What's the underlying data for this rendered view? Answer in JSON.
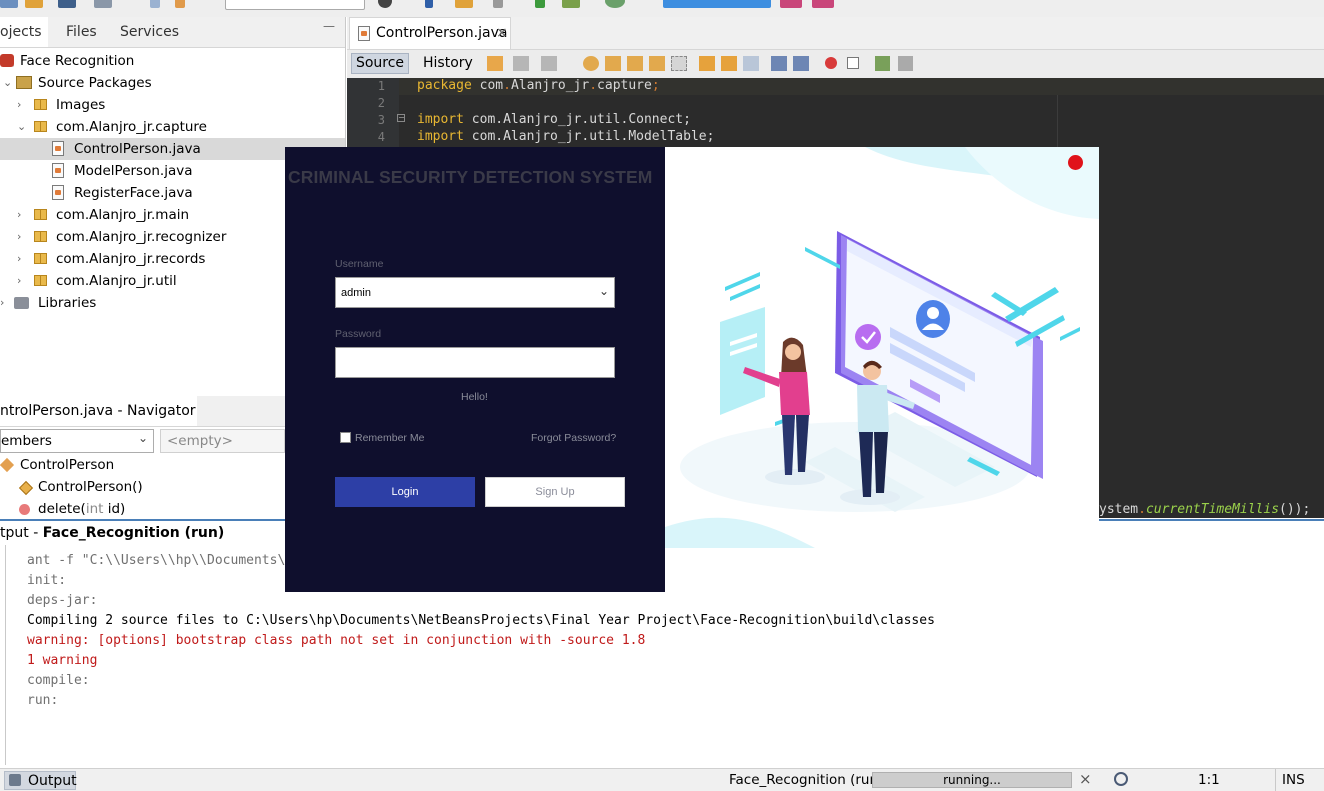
{
  "projects_panel": {
    "tabs": [
      "ojects",
      "Files",
      "Services"
    ],
    "close_glyph": "×",
    "minimize_glyph": "—",
    "tree": [
      {
        "label": "Face Recognition",
        "indent": 0
      },
      {
        "label": "Source Packages",
        "indent": 1
      },
      {
        "label": "Images",
        "indent": 2
      },
      {
        "label": "com.Alanjro_jr.capture",
        "indent": 2
      },
      {
        "label": "ControlPerson.java",
        "indent": 3
      },
      {
        "label": "ModelPerson.java",
        "indent": 3
      },
      {
        "label": "RegisterFace.java",
        "indent": 3
      },
      {
        "label": "com.Alanjro_jr.main",
        "indent": 2
      },
      {
        "label": "com.Alanjro_jr.recognizer",
        "indent": 2
      },
      {
        "label": "com.Alanjro_jr.records",
        "indent": 2
      },
      {
        "label": "com.Alanjro_jr.util",
        "indent": 2
      },
      {
        "label": "Libraries",
        "indent": 1
      }
    ]
  },
  "navigator": {
    "title": "ntrolPerson.java - Navigator",
    "close_glyph": "×",
    "filter_value": "embers",
    "empty_value": "<empty>",
    "items": [
      "ControlPerson",
      "ControlPerson()",
      "delete(int id)"
    ],
    "delete_name": "delete(",
    "delete_type": "int",
    "delete_param": " id)"
  },
  "editor": {
    "tab_label": "ControlPerson.java",
    "tab_close": "×",
    "source_tab": "Source",
    "history_tab": "History",
    "lines": [
      {
        "n": "1",
        "kw": "package",
        "rest": " com",
        "rest2": "Alanjro_jr",
        "rest3": "capture",
        "end": ";"
      },
      {
        "n": "2"
      },
      {
        "n": "3",
        "kw": "import",
        "rest": " com.Alanjro_jr.util.Connect;"
      },
      {
        "n": "4",
        "kw": "import",
        "rest": " com.Alanjro_jr.util.ModelTable;"
      }
    ],
    "fragment_plain": "ystem",
    "fragment_dot": ".",
    "fragment_italic": "currentTimeMillis",
    "fragment_end": "());"
  },
  "output": {
    "title_prefix": "tput - ",
    "title_bold": "Face_Recognition (run)",
    "lines": [
      {
        "text": "ant -f \"C:\\\\Users\\\\hp\\\\Documents\\",
        "color": "gray"
      },
      {
        "text": "init:",
        "color": "gray"
      },
      {
        "text": "deps-jar:",
        "color": "gray"
      },
      {
        "text": "Compiling 2 source files to C:\\Users\\hp\\Documents\\NetBeansProjects\\Final Year Project\\Face-Recognition\\build\\classes",
        "color": "black"
      },
      {
        "text": "warning: [options] bootstrap class path not set in conjunction with -source 1.8",
        "color": "red"
      },
      {
        "text": "1 warning",
        "color": "red"
      },
      {
        "text": "compile:",
        "color": "gray"
      },
      {
        "text": "run:",
        "color": "gray"
      }
    ]
  },
  "status_bar": {
    "output_tab": "Output",
    "task": "Face_Recognition (run)",
    "progress_text": "running...",
    "cancel_glyph": "×",
    "position": "1:1",
    "mode": "INS"
  },
  "login": {
    "title": "CRIMINAL SECURITY DETECTION SYSTEM",
    "username_label": "Username",
    "username_value": "admin",
    "password_label": "Password",
    "password_value": "",
    "hello_text": "Hello!",
    "remember_label": "Remember Me",
    "forgot_label": "Forgot Password?",
    "login_button": "Login",
    "signup_button": "Sign Up"
  },
  "colors": {
    "login_bg": "#0f0f2d",
    "login_button": "#2d3fa6",
    "title_text": "#3a3a48",
    "close_dot": "#e0131a",
    "keyword": "#e8b732"
  }
}
